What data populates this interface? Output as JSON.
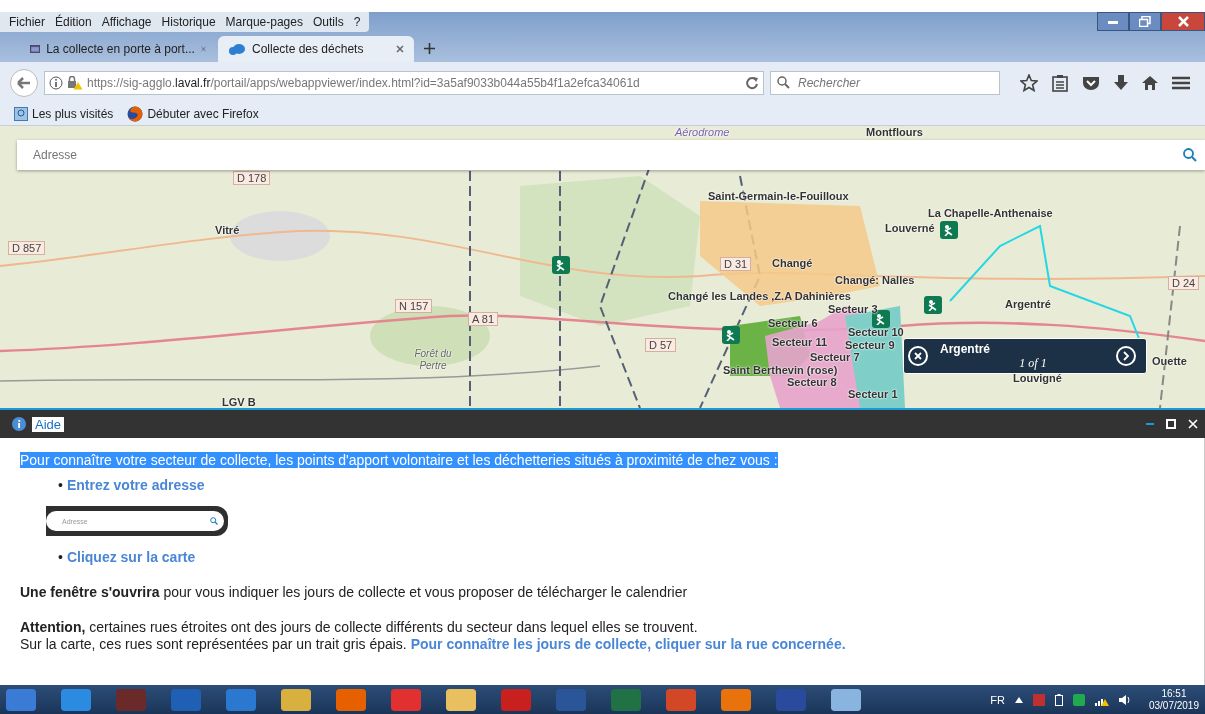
{
  "menu": [
    "Fichier",
    "Édition",
    "Affichage",
    "Historique",
    "Marque-pages",
    "Outils",
    "?"
  ],
  "tabs": [
    {
      "label": "La collecte en porte à port...",
      "selected": false
    },
    {
      "label": "Collecte des déchets",
      "selected": true
    }
  ],
  "address_bar": {
    "url": "https://sig-agglo.**laval.fr**/portail/apps/webappviewer/index.html?id=3a5af9033b044a55b4f1a2efca34061d"
  },
  "search": {
    "placeholder": "Rechercher"
  },
  "bookmarks": [
    "Les plus visités",
    "Débuter avec Firefox"
  ],
  "map": {
    "search": {
      "placeholder": "Adresse"
    },
    "labels": [
      "Aérodrome",
      "Montflours",
      "D 178",
      "Vitré",
      "D 857",
      "Saint-Germain-le-Fouilloux",
      "La Chapelle-Anthenaise",
      "Louverné",
      "Changé",
      "Changé: Nalles",
      "D 31",
      "Changé les Landes ,Z.A Dahinières",
      "Argentré",
      "D 24",
      "N 157",
      "A 81",
      "D 57",
      "Secteur 6",
      "Secteur 3",
      "Secteur 10",
      "Secteur 11",
      "Secteur 9",
      "Secteur 7",
      "Saint Berthevin (rose)",
      "Secteur 8",
      "Secteur 1",
      "Forêt du Pertre",
      "LGV B",
      "Louvigné",
      "Ouette"
    ],
    "popup": {
      "title": "Argentré",
      "count": "1 of 1"
    }
  },
  "panel": {
    "title": "Aide",
    "intro": "Pour connaître votre secteur de collecte, les points d'apport volontaire et les déchetteries situés à proximité de chez vous :",
    "steps": [
      {
        "marker": "•",
        "text": "Entrez votre adresse"
      },
      {
        "marker": "•",
        "text": "Cliquez sur la carte"
      }
    ],
    "example_field": {
      "placeholder": "Adresse"
    },
    "paragraphs": [
      {
        "text": "**Une fenêtre s'ouvrira** pour vous indiquer les jours de collecte et vous proposer de télécharger le calendrier"
      },
      {
        "text": "**Attention,** certaines rues étroites ont des jours de collecte différents du secteur dans lequel elles se trouvent."
      },
      {
        "text": "Sur la carte, ces rues sont représentées par un trait gris épais.",
        "link": "Pour connaître les jours de collecte, cliquer sur la rue concernée."
      }
    ]
  },
  "taskbar": {
    "language": "FR",
    "time": "16:51",
    "date": "03/07/2019"
  }
}
